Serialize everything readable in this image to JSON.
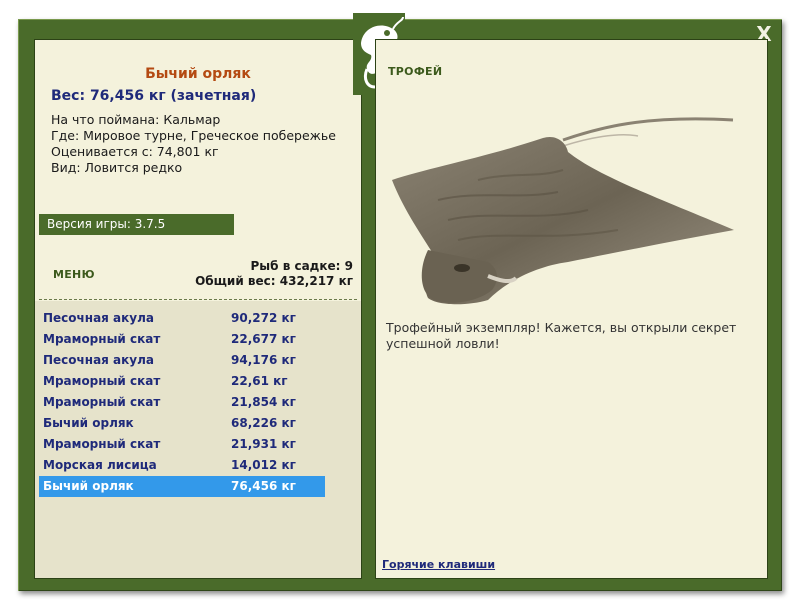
{
  "fish": {
    "name": "Бычий орляк",
    "weight_line": "Вес: 76,456 кг (зачетная)",
    "bait": "На что поймана: Кальмар",
    "location": "Где: Мировое турне, Греческое побережье",
    "value": "Оценивается с: 74,801 кг",
    "kind": "Вид: Ловится редко"
  },
  "version_label": "Версия игры: 3.7.5",
  "menu_label": "МЕНЮ",
  "keepnet": {
    "count_line": "Рыб в садке: 9",
    "total_line": "Общий вес: 432,217 кг"
  },
  "catches": [
    {
      "name": "Песочная акула",
      "weight": "90,272 кг"
    },
    {
      "name": "Мраморный скат",
      "weight": "22,677 кг"
    },
    {
      "name": "Песочная акула",
      "weight": "94,176 кг"
    },
    {
      "name": "Мраморный скат",
      "weight": "22,61 кг"
    },
    {
      "name": "Мраморный скат",
      "weight": "21,854 кг"
    },
    {
      "name": "Бычий орляк",
      "weight": "68,226 кг"
    },
    {
      "name": "Мраморный скат",
      "weight": "21,931 кг"
    },
    {
      "name": "Морская лисица",
      "weight": "14,012 кг"
    },
    {
      "name": "Бычий орляк",
      "weight": "76,456 кг"
    }
  ],
  "selected_index": 8,
  "trophy_label": "ТРОФЕЙ",
  "trophy_text": "Трофейный экземпляр! Кажется, вы открыли секрет успешной ловли!",
  "hotkeys_label": "Горячие клавиши",
  "close_label": "X",
  "colors": {
    "frame": "#4a6b2a",
    "panel": "#f4f2dc",
    "list_bg": "#e6e3cb",
    "title_orange": "#b44a12",
    "text_blue": "#1f2a7a",
    "selection": "#3399ea"
  },
  "icons": {
    "logo": "chameleon-logo-icon",
    "close": "close-icon",
    "trophy_image": "eagle-ray-image"
  }
}
